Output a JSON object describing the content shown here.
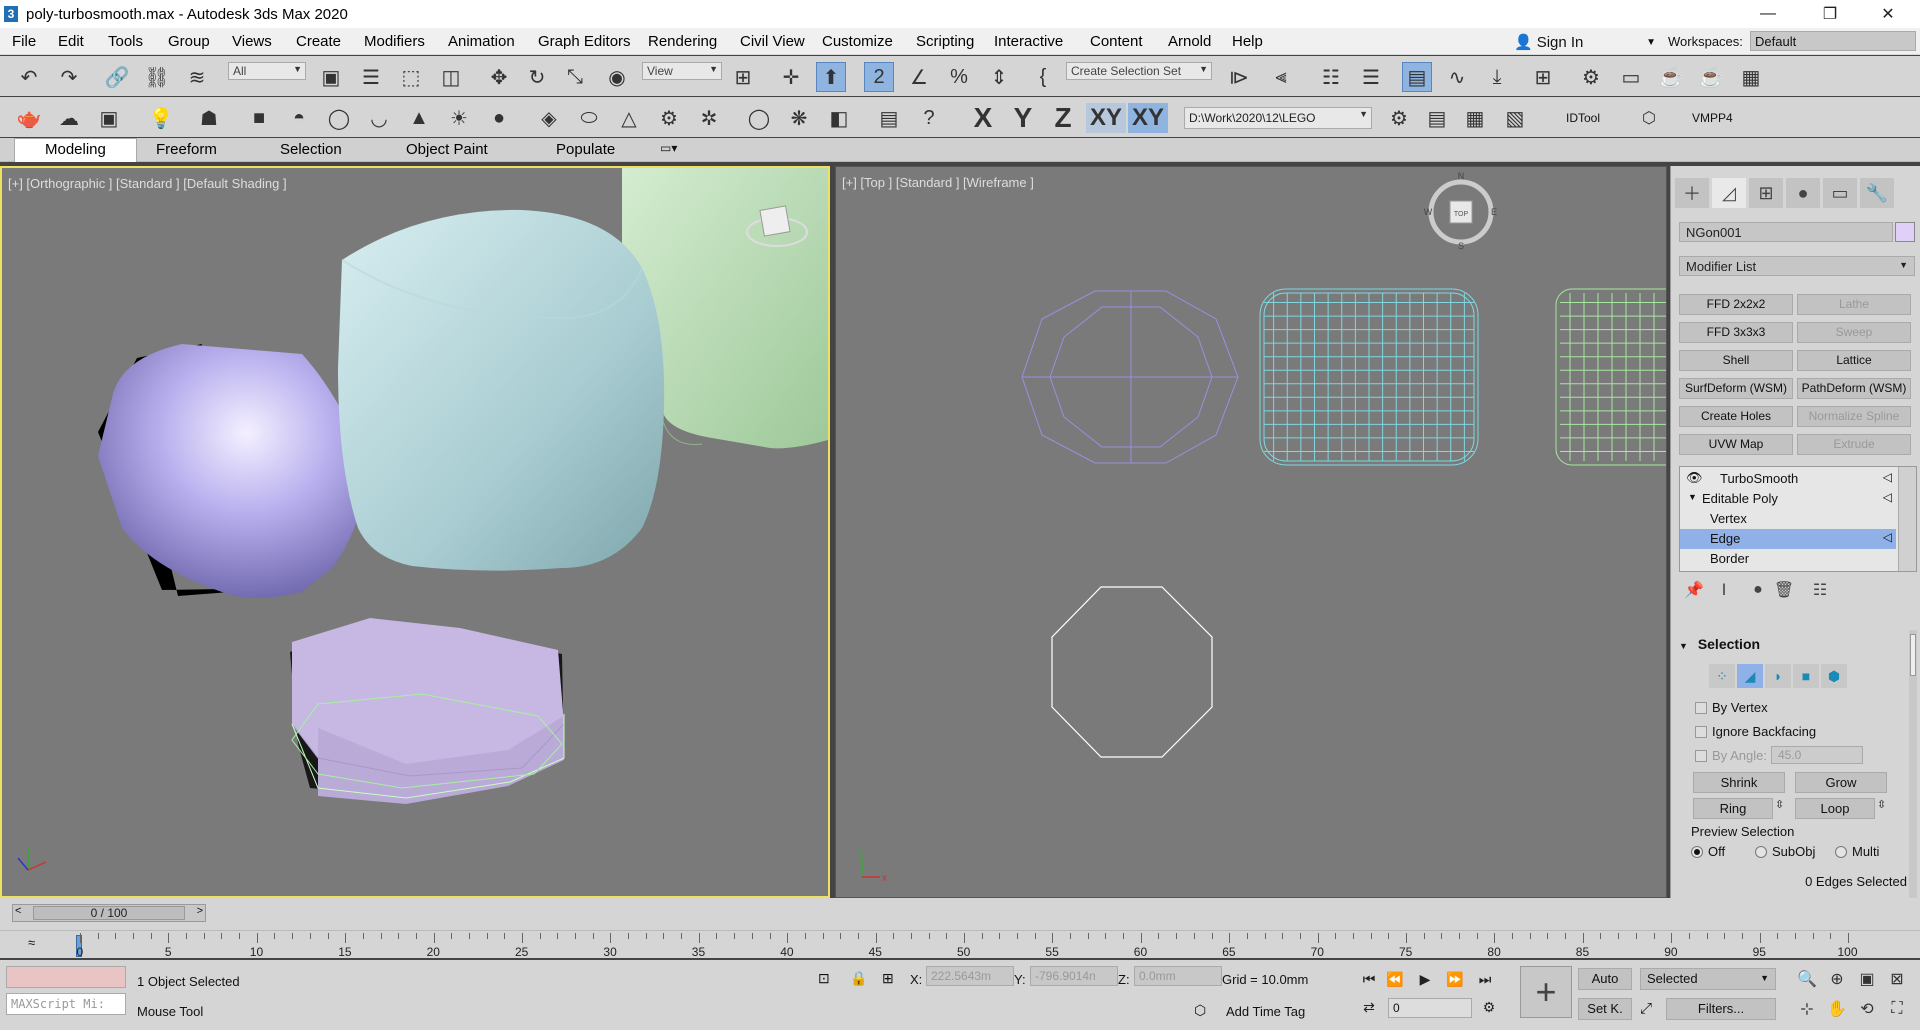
{
  "window": {
    "title": "poly-turbosmooth.max - Autodesk 3ds Max 2020",
    "minimize": "—",
    "restore": "❐",
    "close": "✕"
  },
  "menu": {
    "items": [
      "File",
      "Edit",
      "Tools",
      "Group",
      "Views",
      "Create",
      "Modifiers",
      "Animation",
      "Graph Editors",
      "Rendering",
      "Civil View",
      "Customize",
      "Scripting",
      "Interactive",
      "Content",
      "Arnold",
      "Help"
    ],
    "sign_in": "Sign In",
    "workspaces_label": "Workspaces:",
    "workspace_value": "Default"
  },
  "toolbar": {
    "filter_value": "All",
    "coord_value": "View",
    "selection_set": "Create Selection Set",
    "project_path": "D:\\Work\\2020\\12\\LEGO",
    "idtool": "IDTool",
    "vmpp": "VMPP4",
    "axis_x": "X",
    "axis_y": "Y",
    "axis_z": "Z",
    "axis_xy": "XY",
    "axis_xy2": "XY"
  },
  "ribbon": {
    "tabs": [
      "Modeling",
      "Freeform",
      "Selection",
      "Object Paint",
      "Populate"
    ]
  },
  "viewports": {
    "left_label": "[+] [Orthographic ] [Standard ] [Default Shading ]",
    "right_label": "[+] [Top ] [Standard ] [Wireframe ]",
    "viewcube_top": "TOP",
    "compass_n": "N",
    "compass_s": "S",
    "compass_w": "W",
    "compass_e": "E",
    "gizmo_x": "x",
    "gizmo_y": "y",
    "gizmo_z": "z"
  },
  "command_panel": {
    "object_name": "NGon001",
    "modifier_list": "Modifier List",
    "modifier_buttons": [
      {
        "label": "FFD 2x2x2",
        "enabled": true
      },
      {
        "label": "Lathe",
        "enabled": false
      },
      {
        "label": "FFD 3x3x3",
        "enabled": true
      },
      {
        "label": "Sweep",
        "enabled": false
      },
      {
        "label": "Shell",
        "enabled": true
      },
      {
        "label": "Lattice",
        "enabled": true
      },
      {
        "label": "SurfDeform (WSM)",
        "enabled": true
      },
      {
        "label": "PathDeform (WSM)",
        "enabled": true
      },
      {
        "label": "Create Holes",
        "enabled": true
      },
      {
        "label": "Normalize Spline",
        "enabled": false
      },
      {
        "label": "UVW Map",
        "enabled": true
      },
      {
        "label": "Extrude",
        "enabled": false
      }
    ],
    "stack": [
      {
        "label": "TurboSmooth",
        "selected": false
      },
      {
        "label": "Editable Poly",
        "selected": false
      },
      {
        "label": "Vertex",
        "selected": false
      },
      {
        "label": "Edge",
        "selected": true
      },
      {
        "label": "Border",
        "selected": false
      }
    ],
    "selection_rollout": {
      "title": "Selection",
      "by_vertex": "By Vertex",
      "ignore_backfacing": "Ignore Backfacing",
      "by_angle": "By Angle:",
      "by_angle_value": "45.0",
      "shrink": "Shrink",
      "grow": "Grow",
      "ring": "Ring",
      "loop": "Loop",
      "preview_selection": "Preview Selection",
      "preview_off": "Off",
      "preview_subobj": "SubObj",
      "preview_multi": "Multi",
      "status": "0 Edges Selected"
    }
  },
  "timeline": {
    "slider_label": "0 / 100",
    "ticks": [
      "0",
      "5",
      "10",
      "15",
      "20",
      "25",
      "30",
      "35",
      "40",
      "45",
      "50",
      "55",
      "60",
      "65",
      "70",
      "75",
      "80",
      "85",
      "90",
      "95",
      "100"
    ]
  },
  "status": {
    "maxscript_placeholder": "MAXScript Mi:",
    "selection_status": "1 Object Selected",
    "prompt": "Mouse Tool",
    "x_label": "X:",
    "x_value": "222.5643m",
    "y_label": "Y:",
    "y_value": "-796.9014n",
    "z_label": "Z:",
    "z_value": "0.0mm",
    "grid": "Grid = 10.0mm",
    "add_time_tag": "Add Time Tag",
    "auto_key": "Auto",
    "set_key": "Set K.",
    "key_filter": "Selected",
    "filters": "Filters...",
    "frame_value": "0"
  },
  "colors": {
    "active_viewport_border": "#f0e060",
    "selected_stack_item": "#8fb1e8",
    "ngon_wire": "#9b8fe0",
    "box_wire": "#7fd8e0",
    "green_wire": "#a8e8a0"
  }
}
